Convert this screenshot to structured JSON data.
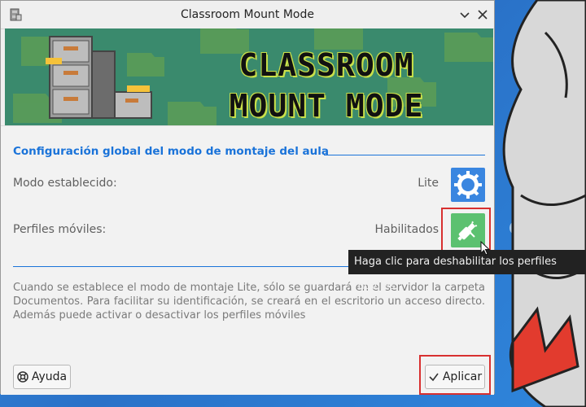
{
  "window": {
    "title": "Classroom Mount Mode"
  },
  "banner": {
    "line1": "CLASSROOM",
    "line2": "MOUNT MODE"
  },
  "section": {
    "title": "Configuración global del modo de montaje del aula"
  },
  "rows": {
    "mode_label": "Modo establecido:",
    "mode_value": "Lite",
    "profiles_label": "Perfiles móviles:",
    "profiles_value": "Habilitados"
  },
  "tooltip": {
    "text": "Haga clic para deshabilitar los perfiles móviles"
  },
  "description": "Cuando se establece el modo de montaje Lite, sólo se guardará en el servidor la carpeta Documentos. Para facilitar su identificación, se creará en el escritorio un acceso directo. Además puede activar o desactivar los perfiles móviles",
  "buttons": {
    "help_label": "Ayuda",
    "apply_label": "Aplicar"
  },
  "icons": {
    "app": "file-cabinet-icon",
    "minimize": "chevron-down-icon",
    "close": "close-icon",
    "mode": "gear-icon",
    "profiles": "usb-plug-icon",
    "help": "lifebuoy-icon",
    "apply": "checkmark-icon"
  },
  "colors": {
    "accent": "#1a73d9",
    "mode_button": "#3a86e0",
    "profiles_button": "#5cc170",
    "highlight": "#d83030"
  }
}
